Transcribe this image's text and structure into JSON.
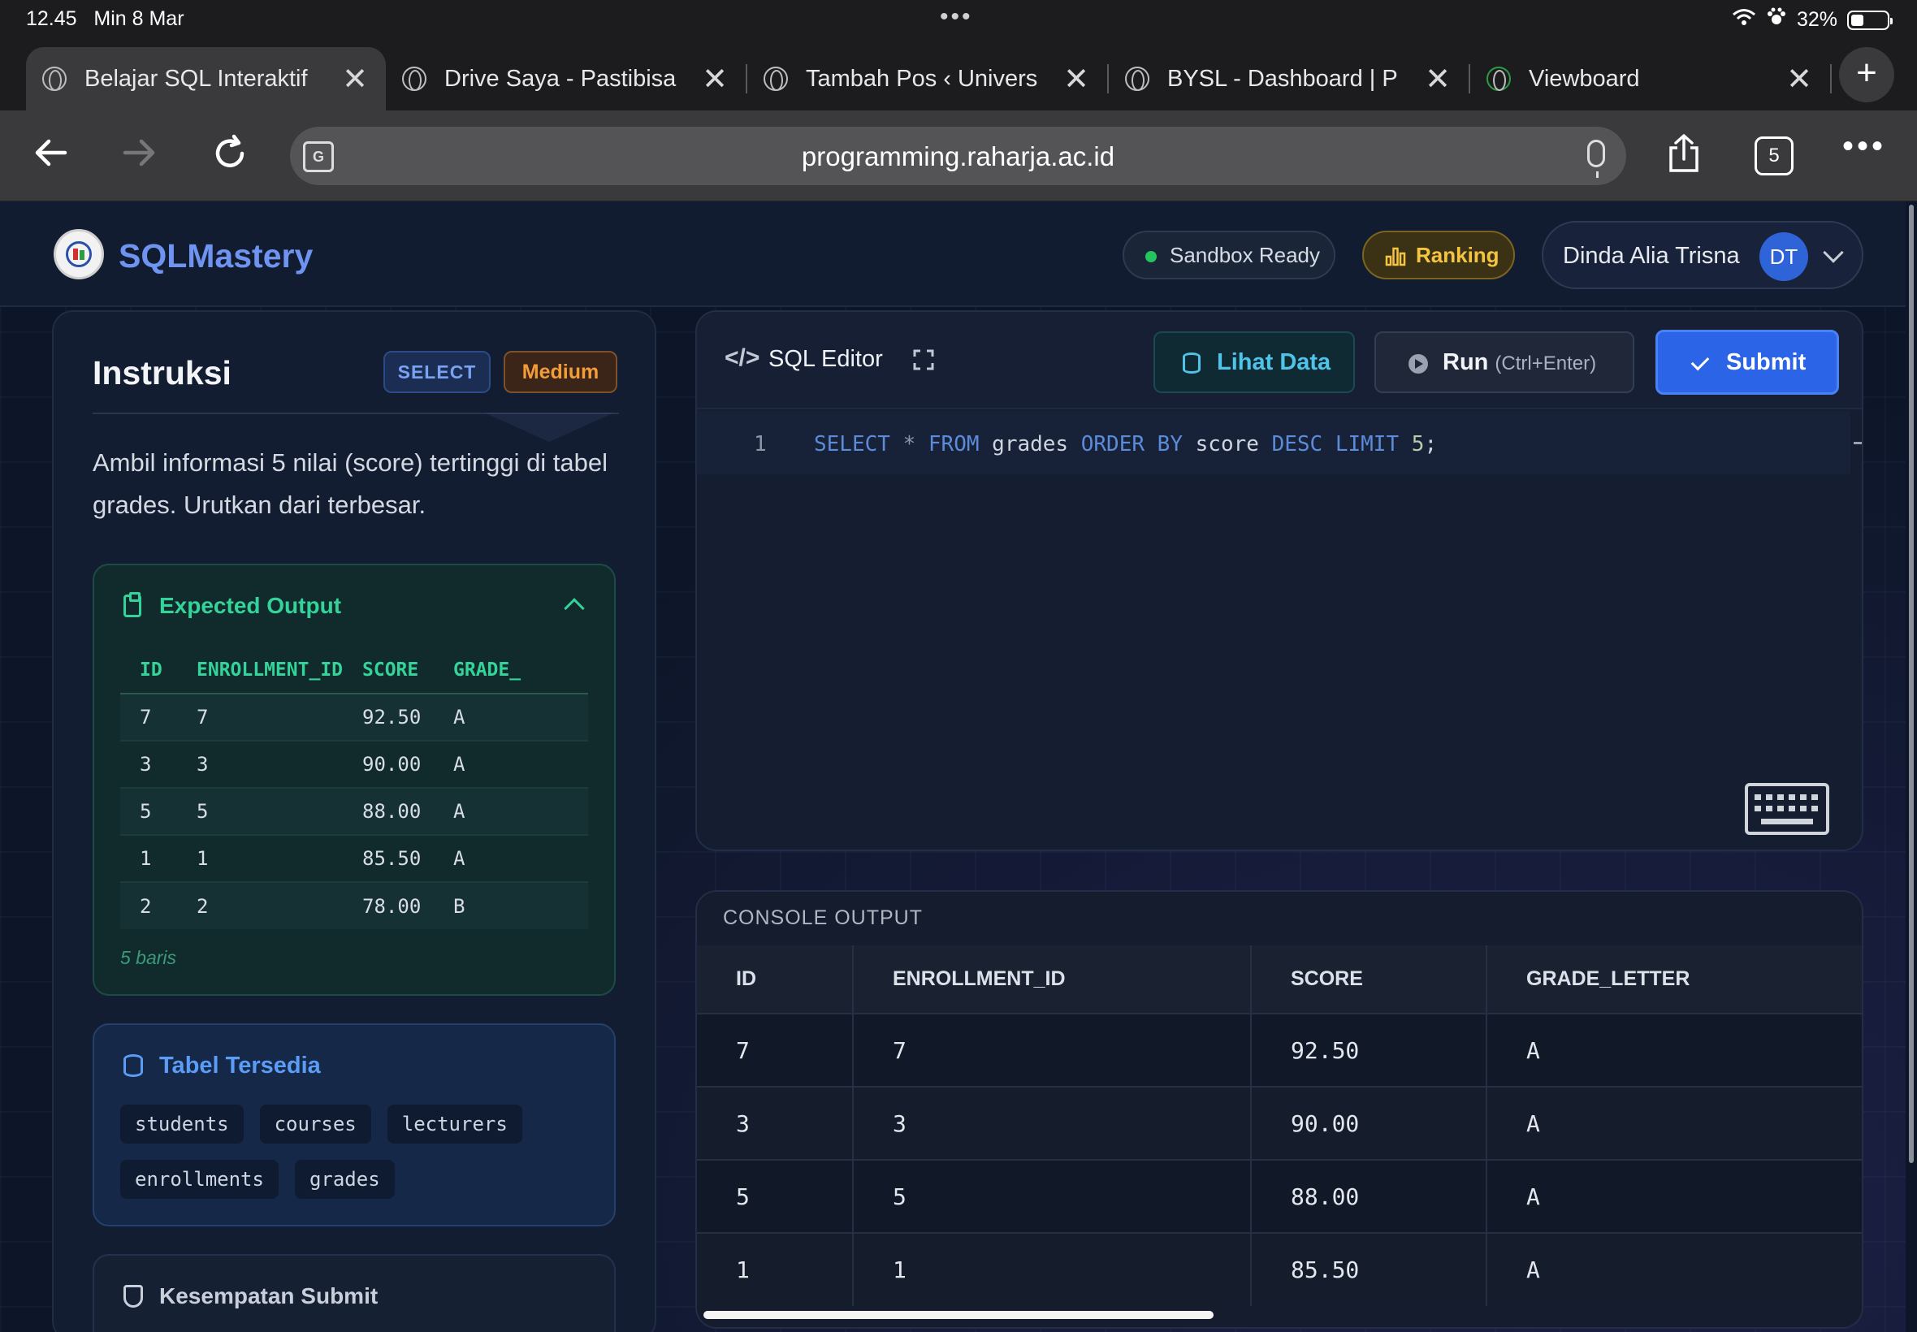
{
  "status_bar": {
    "time": "12.45",
    "date": "Min 8 Mar",
    "battery": "32%"
  },
  "browser": {
    "tabs": [
      {
        "title": "Belajar SQL Interaktif",
        "active": true
      },
      {
        "title": "Drive Saya - Pastibisa",
        "active": false
      },
      {
        "title": "Tambah Pos ‹ Univers",
        "active": false
      },
      {
        "title": "BYSL - Dashboard | P",
        "active": false
      },
      {
        "title": "Viewboard",
        "active": false
      }
    ],
    "url": "programming.raharja.ac.id",
    "tab_count": "5"
  },
  "header": {
    "brand": "SQLMastery",
    "sandbox_status": "Sandbox Ready",
    "ranking_label": "Ranking",
    "user_name": "Dinda Alia Trisna",
    "user_initials": "DT"
  },
  "instructions": {
    "title": "Instruksi",
    "badge_type": "SELECT",
    "badge_level": "Medium",
    "text": "Ambil informasi 5 nilai (score) tertinggi di tabel grades. Urutkan dari terbesar.",
    "expected_output": {
      "title": "Expected Output",
      "columns": [
        "ID",
        "ENROLLMENT_ID",
        "SCORE",
        "GRADE_"
      ],
      "rows": [
        [
          "7",
          "7",
          "92.50",
          "A"
        ],
        [
          "3",
          "3",
          "90.00",
          "A"
        ],
        [
          "5",
          "5",
          "88.00",
          "A"
        ],
        [
          "1",
          "1",
          "85.50",
          "A"
        ],
        [
          "2",
          "2",
          "78.00",
          "B"
        ]
      ],
      "footer": "5 baris"
    },
    "tables_available": {
      "title": "Tabel Tersedia",
      "tables": [
        "students",
        "courses",
        "lecturers",
        "enrollments",
        "grades"
      ]
    },
    "submit_chances": {
      "title": "Kesempatan Submit"
    }
  },
  "editor": {
    "title": "SQL Editor",
    "btn_view_data": "Lihat Data",
    "btn_run": "Run",
    "btn_run_hint": "(Ctrl+Enter)",
    "btn_submit": "Submit",
    "line_number": "1",
    "code_tokens": [
      {
        "t": "SELECT",
        "c": "kw"
      },
      {
        "t": " ",
        "c": "id"
      },
      {
        "t": "*",
        "c": "op"
      },
      {
        "t": " ",
        "c": "id"
      },
      {
        "t": "FROM",
        "c": "kw"
      },
      {
        "t": " grades ",
        "c": "id"
      },
      {
        "t": "ORDER BY",
        "c": "kw"
      },
      {
        "t": " score ",
        "c": "id"
      },
      {
        "t": "DESC",
        "c": "kw"
      },
      {
        "t": " ",
        "c": "id"
      },
      {
        "t": "LIMIT",
        "c": "kw"
      },
      {
        "t": " ",
        "c": "id"
      },
      {
        "t": "5",
        "c": "num"
      },
      {
        "t": ";",
        "c": "id"
      }
    ]
  },
  "console": {
    "title": "CONSOLE OUTPUT",
    "columns": [
      "ID",
      "ENROLLMENT_ID",
      "SCORE",
      "GRADE_LETTER"
    ],
    "rows": [
      [
        "7",
        "7",
        "92.50",
        "A"
      ],
      [
        "3",
        "3",
        "90.00",
        "A"
      ],
      [
        "5",
        "5",
        "88.00",
        "A"
      ],
      [
        "1",
        "1",
        "85.50",
        "A"
      ]
    ]
  }
}
